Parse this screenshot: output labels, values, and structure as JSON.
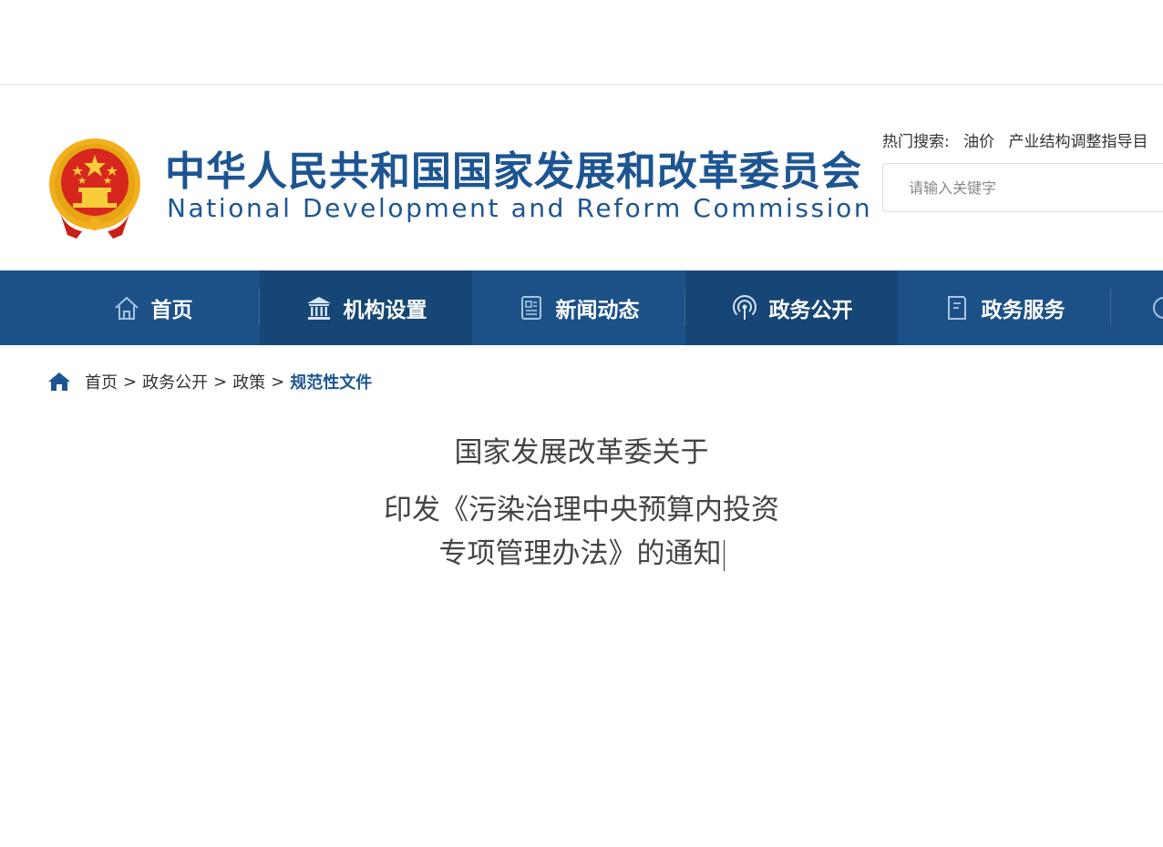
{
  "header": {
    "title_cn": "中华人民共和国国家发展和改革委员会",
    "title_en": "National Development and Reform Commission",
    "hot_search_label": "热门搜索:",
    "hot_search_items": [
      "油价",
      "产业结构调整指导目"
    ],
    "search_placeholder": "请输入关键字"
  },
  "nav": {
    "items": [
      {
        "label": "首页",
        "icon": "home-outline-icon"
      },
      {
        "label": "机构设置",
        "icon": "institution-building-icon"
      },
      {
        "label": "新闻动态",
        "icon": "news-document-icon"
      },
      {
        "label": "政务公开",
        "icon": "broadcast-signal-icon"
      },
      {
        "label": "政务服务",
        "icon": "service-book-icon"
      }
    ]
  },
  "breadcrumb": {
    "items": [
      "首页",
      "政务公开",
      "政策"
    ],
    "separator": ">",
    "current": "规范性文件"
  },
  "article": {
    "title_line1": "国家发展改革委关于",
    "title_line2a": "印发《污染治理中央预算内投资",
    "title_line2b": "专项管理办法》的通知"
  },
  "colors": {
    "brand_blue": "#1d5592",
    "nav_bg": "#1c5188",
    "nav_active_bg": "#154675",
    "emblem_red": "#d7261d",
    "emblem_gold": "#f2b01e"
  }
}
